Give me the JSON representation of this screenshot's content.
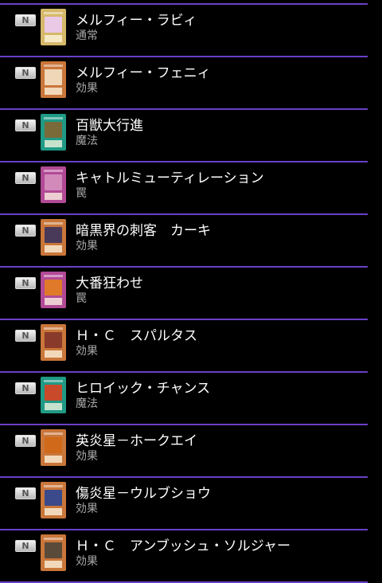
{
  "rarity_label": "N",
  "colors": {
    "divider": "#6a3fc8",
    "name_text": "#ffffff",
    "type_text": "#a8a8a8"
  },
  "cards": [
    {
      "name": "メルフィー・ラビィ",
      "type": "通常",
      "frame": "normal",
      "frame_color": "#d6b86a",
      "art_color": "#e9c9e6"
    },
    {
      "name": "メルフィー・フェニィ",
      "type": "効果",
      "frame": "effect",
      "frame_color": "#c9763a",
      "art_color": "#f0d7b8"
    },
    {
      "name": "百獣大行進",
      "type": "魔法",
      "frame": "spell",
      "frame_color": "#1f9a85",
      "art_color": "#7a6a3a"
    },
    {
      "name": "キャトルミューティレーション",
      "type": "罠",
      "frame": "trap",
      "frame_color": "#b24a96",
      "art_color": "#d28abb"
    },
    {
      "name": "暗黒界の刺客　カーキ",
      "type": "効果",
      "frame": "effect",
      "frame_color": "#c9763a",
      "art_color": "#4a3a5a"
    },
    {
      "name": "大番狂わせ",
      "type": "罠",
      "frame": "trap",
      "frame_color": "#b24a96",
      "art_color": "#e07a2a"
    },
    {
      "name": "Ｈ・Ｃ　スパルタス",
      "type": "効果",
      "frame": "effect",
      "frame_color": "#c9763a",
      "art_color": "#8a3a2a"
    },
    {
      "name": "ヒロイック・チャンス",
      "type": "魔法",
      "frame": "spell",
      "frame_color": "#1f9a85",
      "art_color": "#c84a2a"
    },
    {
      "name": "英炎星－ホークエイ",
      "type": "効果",
      "frame": "effect",
      "frame_color": "#c9763a",
      "art_color": "#d06a1a"
    },
    {
      "name": "傷炎星－ウルブショウ",
      "type": "効果",
      "frame": "effect",
      "frame_color": "#c9763a",
      "art_color": "#3a4a8a"
    },
    {
      "name": "Ｈ・Ｃ　アンブッシュ・ソルジャー",
      "type": "効果",
      "frame": "effect",
      "frame_color": "#c9763a",
      "art_color": "#5a4a3a"
    }
  ]
}
